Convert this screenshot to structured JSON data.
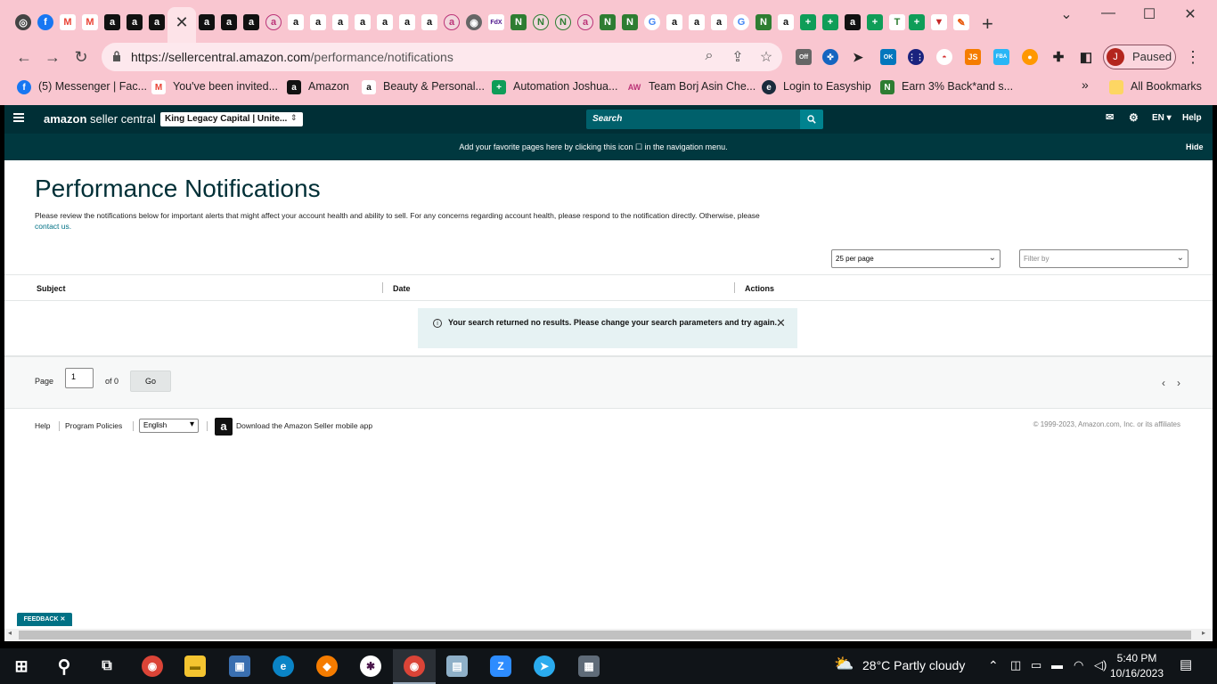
{
  "browser": {
    "url_host": "https://sellercentral.amazon.com",
    "url_path": "/performance/notifications",
    "profile_initial": "J",
    "profile_label": "Paused",
    "ext_badge_off": "Off",
    "ext_badge_ok": "OK",
    "ext_js": "JS",
    "ext_fba": "FBA",
    "bookmarks": [
      {
        "label": "(5) Messenger | Fac...",
        "icon": "facebook-icon",
        "color": "#1877f2"
      },
      {
        "label": "You've been invited...",
        "icon": "gmail-icon",
        "color": "#ea4335"
      },
      {
        "label": "Amazon",
        "icon": "amazon-icon",
        "color": "#111111"
      },
      {
        "label": "Beauty & Personal...",
        "icon": "amazon-smile-icon",
        "color": "#ffffff"
      },
      {
        "label": "Automation Joshua...",
        "icon": "sheets-icon",
        "color": "#0f9d58"
      },
      {
        "label": "Team Borj Asin Che...",
        "icon": "asin-icon",
        "color": "#e0a0b0"
      },
      {
        "label": "Login to Easyship",
        "icon": "easyship-icon",
        "color": "#1a2b3c"
      },
      {
        "label": "Earn 3% Back*and s...",
        "icon": "rakuten-icon",
        "color": "#2e7d32"
      }
    ],
    "all_bookmarks": "All Bookmarks",
    "overflow": "»"
  },
  "header": {
    "logo_brand": "amazon",
    "logo_product": "seller central",
    "account": "King Legacy Capital | Unite...",
    "search_placeholder": "Search",
    "lang": "EN",
    "help": "Help",
    "fav_message": "Add your favorite pages here by clicking this icon ☐ in the navigation menu.",
    "fav_hide": "Hide"
  },
  "main": {
    "title": "Performance Notifications",
    "description": "Please review the notifications below for important alerts that might affect your account health and ability to sell. For any concerns regarding account health, please respond to the notification directly. Otherwise, please",
    "contact_link": "contact us.",
    "per_page": "25 per page",
    "filter_placeholder": "Filter by",
    "columns": [
      "Subject",
      "Date",
      "Actions"
    ],
    "no_results": "Your search returned no results. Please change your search parameters and try again.",
    "pager": {
      "page_label": "Page",
      "page_value": "1",
      "of_label": "of 0",
      "go": "Go"
    }
  },
  "footer": {
    "help": "Help",
    "policies": "Program Policies",
    "language": "English",
    "app_download": "Download the Amazon Seller mobile app",
    "copyright": "© 1999-2023, Amazon.com, Inc. or its affiliates",
    "feedback": "FEEDBACK ✕"
  },
  "taskbar": {
    "weather": "28°C  Partly cloudy",
    "time": "5:40 PM",
    "date": "10/16/2023"
  }
}
